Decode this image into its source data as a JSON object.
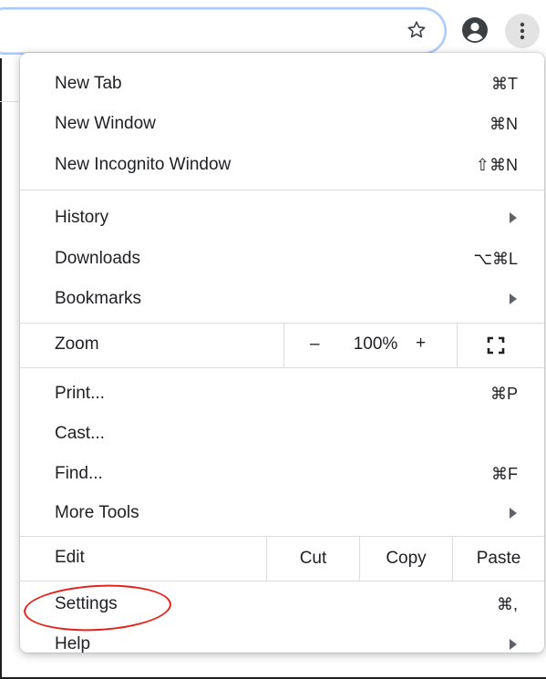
{
  "toolbar": {
    "icons": {
      "bookmark": "star-icon",
      "profile": "profile-icon",
      "menu": "kebab-menu-icon"
    }
  },
  "menu": {
    "items": {
      "new_tab": {
        "label": "New Tab",
        "shortcut": "⌘T"
      },
      "new_window": {
        "label": "New Window",
        "shortcut": "⌘N"
      },
      "new_incognito": {
        "label": "New Incognito Window",
        "shortcut": "⇧⌘N"
      },
      "history": {
        "label": "History"
      },
      "downloads": {
        "label": "Downloads",
        "shortcut": "⌥⌘L"
      },
      "bookmarks": {
        "label": "Bookmarks"
      },
      "print": {
        "label": "Print...",
        "shortcut": "⌘P"
      },
      "cast": {
        "label": "Cast..."
      },
      "find": {
        "label": "Find...",
        "shortcut": "⌘F"
      },
      "more_tools": {
        "label": "More Tools"
      },
      "settings": {
        "label": "Settings",
        "shortcut": "⌘,"
      },
      "help": {
        "label": "Help"
      }
    },
    "zoom": {
      "label": "Zoom",
      "minus": "–",
      "value": "100%",
      "plus": "+"
    },
    "edit": {
      "label": "Edit",
      "cut": "Cut",
      "copy": "Copy",
      "paste": "Paste"
    }
  },
  "annotation": {
    "color": "#e5231b",
    "target": "Settings"
  },
  "colors": {
    "separator": "#dadce0",
    "omnibox_border": "#a8c7fa",
    "menu_button_bg": "#e3e3e3"
  }
}
